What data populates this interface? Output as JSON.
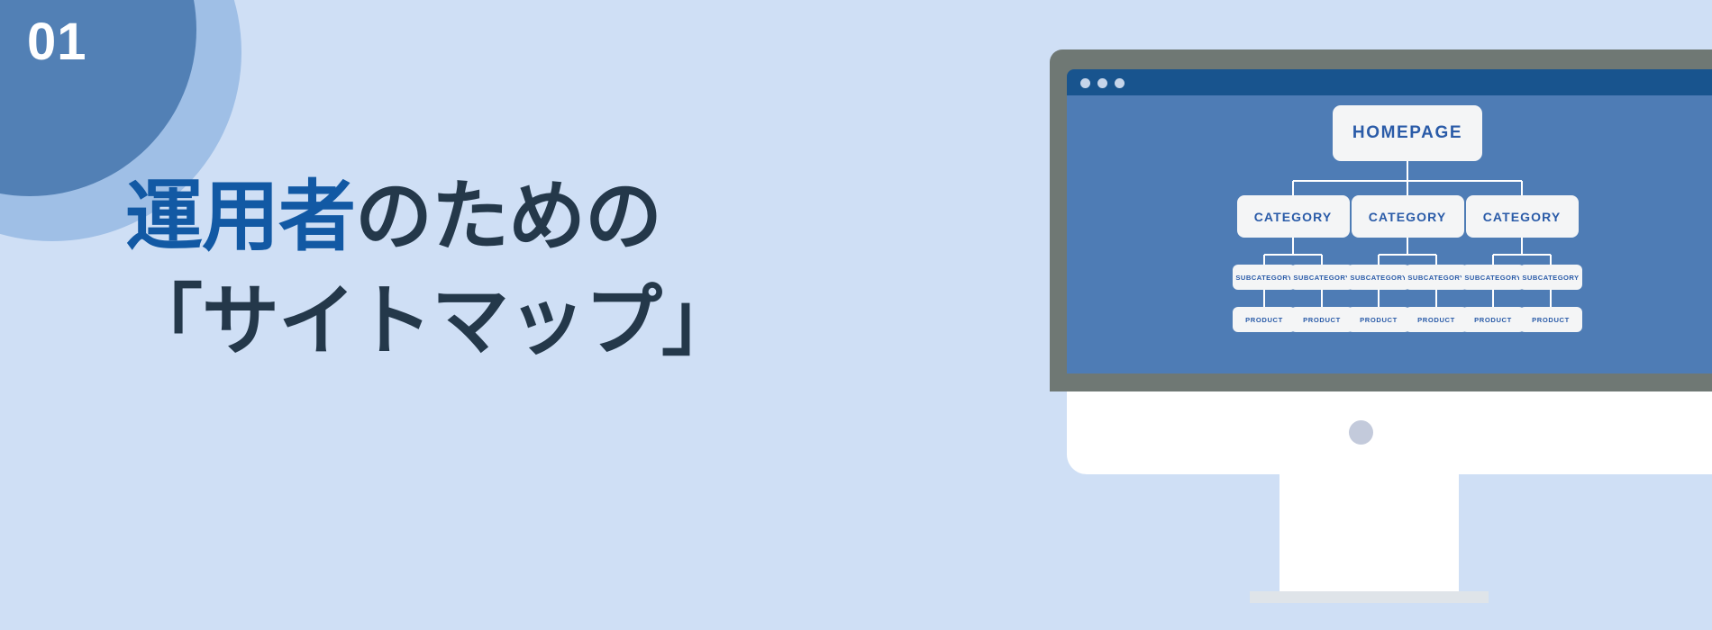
{
  "theme": {
    "background": "#cfdff5",
    "accent_blue": "#1259a4",
    "text_dark": "#24384a",
    "circle_inner": "#5280b5",
    "circle_outer": "#9fbfe6",
    "monitor_bezel": "#6f7874",
    "titlebar": "#18548e",
    "screen": "#4e7cb5",
    "node_bg": "#f4f5f6",
    "node_text": "#2a5ba8"
  },
  "badge": {
    "number": "01"
  },
  "headline": {
    "line1_accent": "運用者",
    "line1_rest": "のための",
    "line2": "「サイトマップ」"
  },
  "browser": {
    "dots": [
      "dot-red",
      "dot-yellow",
      "dot-green"
    ]
  },
  "sitemap": {
    "root": {
      "label": "HOMEPAGE"
    },
    "categories": [
      {
        "label": "CATEGORY",
        "subcategories": [
          {
            "label": "SUBCATEGORY",
            "products": [
              {
                "label": "PRODUCT"
              }
            ]
          },
          {
            "label": "SUBCATEGORY",
            "products": [
              {
                "label": "PRODUCT"
              }
            ]
          }
        ]
      },
      {
        "label": "CATEGORY",
        "subcategories": [
          {
            "label": "SUBCATEGORY",
            "products": [
              {
                "label": "PRODUCT"
              }
            ]
          },
          {
            "label": "SUBCATEGORY",
            "products": [
              {
                "label": "PRODUCT"
              }
            ]
          }
        ]
      },
      {
        "label": "CATEGORY",
        "subcategories": [
          {
            "label": "SUBCATEGORY",
            "products": [
              {
                "label": "PRODUCT"
              }
            ]
          },
          {
            "label": "SUBCATEGORY",
            "products": [
              {
                "label": "PRODUCT"
              }
            ]
          }
        ]
      }
    ]
  }
}
